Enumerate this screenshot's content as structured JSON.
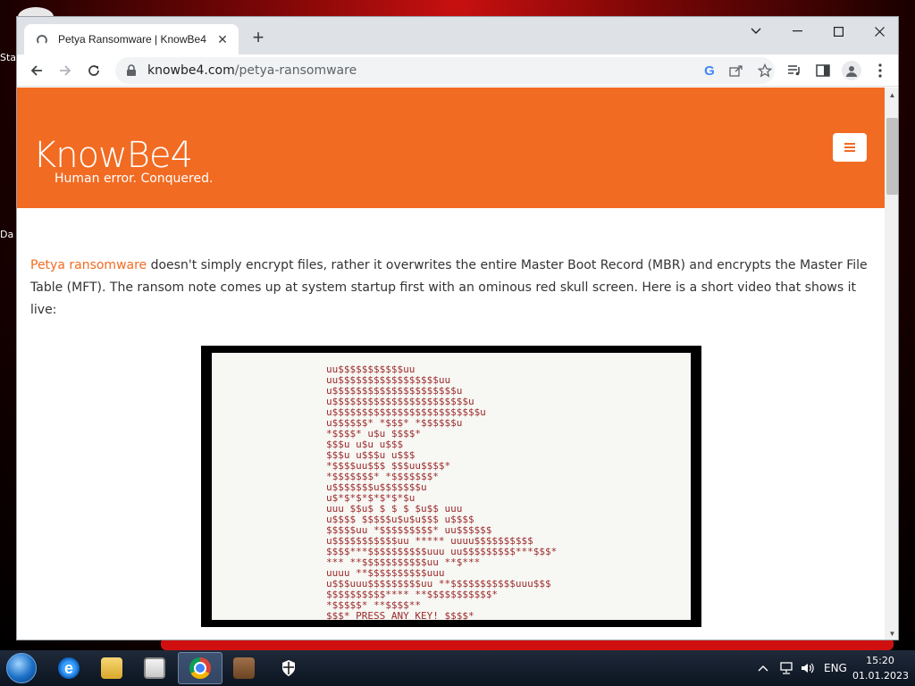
{
  "desktop": {
    "icon1_label": "Sta",
    "icon2_label": "Da"
  },
  "browser": {
    "tab": {
      "title": "Petya Ransomware | KnowBe4",
      "close_label": "✕"
    },
    "new_tab_label": "+",
    "window_controls": {
      "tab_search": "⌄",
      "minimize": "—",
      "maximize": "☐",
      "close": "✕"
    },
    "address": {
      "domain": "knowbe4.com",
      "path": "/petya-ransomware"
    }
  },
  "site": {
    "logo_text": "KnowBe4",
    "tagline": "Human error. Conquered.",
    "brand_color": "#f26b22"
  },
  "article": {
    "link_text": "Petya ransomware",
    "body_text": " doesn't simply encrypt files, rather it overwrites the entire Master Boot Record (MBR) and encrypts the Master File Table (MFT). The ransom note comes up at system startup first with an ominous red skull screen. Here is a short video that shows it live:"
  },
  "video": {
    "skull_lines": [
      "              uu$$$$$$$$$$$uu",
      "          uu$$$$$$$$$$$$$$$$$uu",
      "         u$$$$$$$$$$$$$$$$$$$$$u",
      "        u$$$$$$$$$$$$$$$$$$$$$$$u",
      "       u$$$$$$$$$$$$$$$$$$$$$$$$$u",
      "       u$$$$$$*   *$$$*   *$$$$$$u",
      "       *$$$$*      u$u       $$$$*",
      "        $$$u       u$u       u$$$",
      "        $$$u      u$$$u      u$$$",
      "         *$$$$uu$$$   $$$uu$$$$*",
      "          *$$$$$$$*   *$$$$$$$*",
      "            u$$$$$$$u$$$$$$$u",
      "             u$*$*$*$*$*$*$u",
      "  uuu        $$u$ $ $ $ $u$$       uuu",
      " u$$$$        $$$$$u$u$u$$$       u$$$$",
      "  $$$$$uu      *$$$$$$$$$*     uu$$$$$$",
      "u$$$$$$$$$$$uu    *****    uuuu$$$$$$$$$$",
      "$$$$***$$$$$$$$$$uuu   uu$$$$$$$$$***$$$*",
      " ***      **$$$$$$$$$$$uu **$***",
      "          uuuu **$$$$$$$$$$uuu",
      " u$$$uuu$$$$$$$$$uu **$$$$$$$$$$$uuu$$$",
      " $$$$$$$$$$****           **$$$$$$$$$$$*",
      "   *$$$$$*                      **$$$$**",
      "     $$$*     PRESS ANY KEY!       $$$$*"
    ]
  },
  "taskbar": {
    "language": "ENG",
    "time": "15:20",
    "date": "01.01.2023"
  }
}
